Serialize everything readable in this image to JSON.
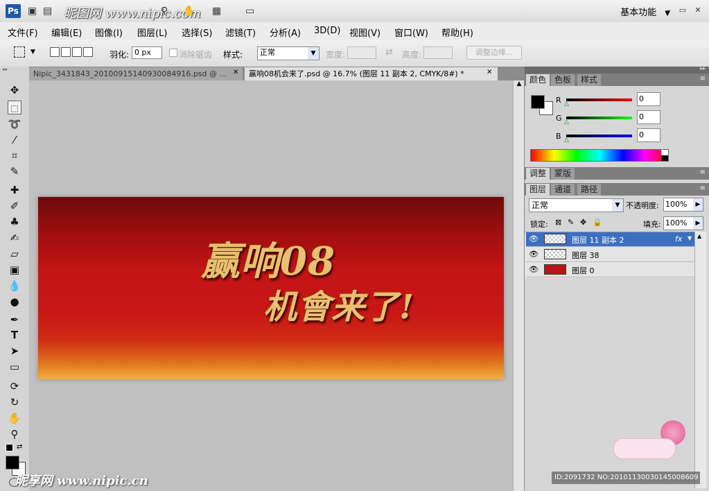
{
  "app": {
    "logo": "Ps",
    "watermark": "昵图网 www.nipic.com",
    "workspace_label": "基本功能",
    "win_minimize": "–",
    "win_restore": "▭",
    "win_close": "✕"
  },
  "menu": [
    "文件(F)",
    "编辑(E)",
    "图像(I)",
    "图层(L)",
    "选择(S)",
    "滤镜(T)",
    "分析(A)",
    "3D(D)",
    "视图(V)",
    "窗口(W)",
    "帮助(H)"
  ],
  "options": {
    "feather_label": "羽化:",
    "feather_value": "0 px",
    "antialias_label": "消除锯齿",
    "style_label": "样式:",
    "style_value": "正常",
    "width_label": "宽度:",
    "height_label": "高度:",
    "refine_edge_label": "调整边缘..."
  },
  "tabs": [
    {
      "label": "Nipic_3431843_20100915140930084916.psd @ ...",
      "active": false
    },
    {
      "label": "赢响08机会来了.psd @ 16.7% (图层 11 副本 2, CMYK/8#) *",
      "active": true
    }
  ],
  "artwork": {
    "line1": "赢响08",
    "line2": "机會来了!"
  },
  "color_panel": {
    "tabs": [
      "颜色",
      "色板",
      "样式"
    ],
    "r_label": "R",
    "r_value": "0",
    "g_label": "G",
    "g_value": "0",
    "b_label": "B",
    "b_value": "0"
  },
  "adjust_panel": {
    "tabs": [
      "调整",
      "蒙版"
    ]
  },
  "layers_panel": {
    "tabs": [
      "图层",
      "通道",
      "路径"
    ],
    "blend_mode": "正常",
    "opacity_label": "不透明度:",
    "opacity_value": "100%",
    "lock_label": "锁定:",
    "fill_label": "填充:",
    "fill_value": "100%",
    "layers": [
      {
        "name": "图层 11 副本 2",
        "selected": true,
        "fx": "fx"
      },
      {
        "name": "图层 38",
        "selected": false
      },
      {
        "name": "图层 0",
        "selected": false
      }
    ]
  },
  "watermark_bottom_left": "昵享网 www.nipic.cn",
  "watermark_bottom_right": "ID:2091732 NO:20101130030145008609",
  "colors": {
    "selection": "#3d6fc0",
    "banner_red": "#c41414",
    "gold": "#e7c071"
  }
}
